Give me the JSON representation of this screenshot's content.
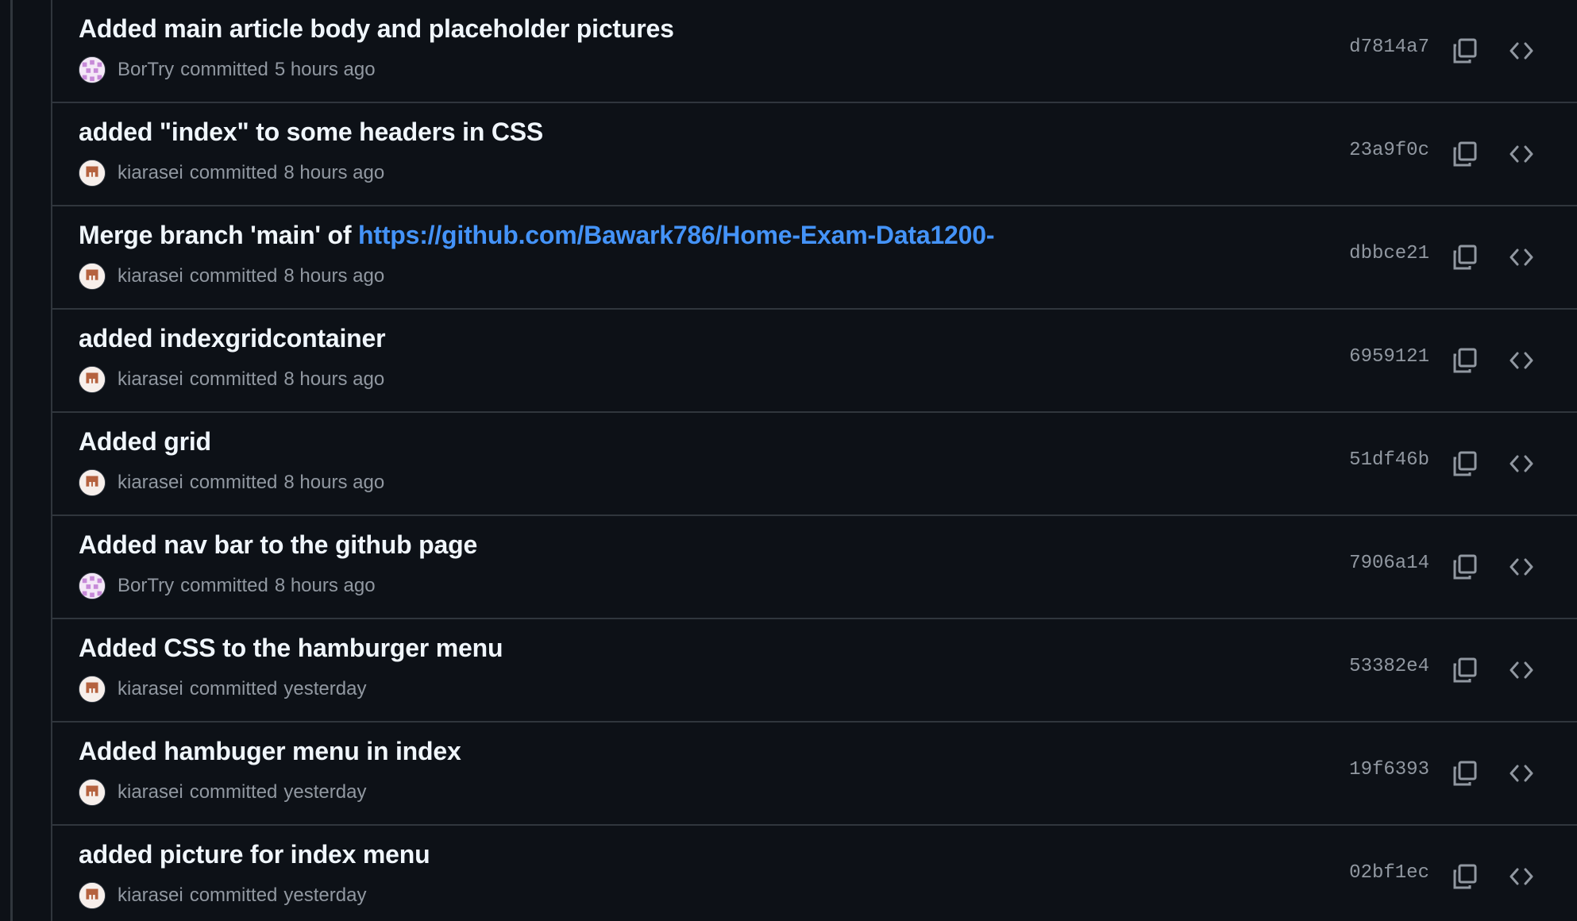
{
  "commits": [
    {
      "title": "Added main article body and placeholder pictures",
      "author": "BorTry",
      "avatar": "bortry-avatar",
      "verb": "committed",
      "time": "5 hours ago",
      "sha": "d7814a7"
    },
    {
      "title": "added \"index\" to some headers in CSS",
      "author": "kiarasei",
      "avatar": "kiarasei-avatar",
      "verb": "committed",
      "time": "8 hours ago",
      "sha": "23a9f0c"
    },
    {
      "title_prefix": "Merge branch 'main' of ",
      "title_link": "https://github.com/Bawark786/Home-Exam-Data1200-",
      "author": "kiarasei",
      "avatar": "kiarasei-avatar",
      "verb": "committed",
      "time": "8 hours ago",
      "sha": "dbbce21"
    },
    {
      "title": "added indexgridcontainer",
      "author": "kiarasei",
      "avatar": "kiarasei-avatar",
      "verb": "committed",
      "time": "8 hours ago",
      "sha": "6959121"
    },
    {
      "title": "Added grid",
      "author": "kiarasei",
      "avatar": "kiarasei-avatar",
      "verb": "committed",
      "time": "8 hours ago",
      "sha": "51df46b"
    },
    {
      "title": "Added nav bar to the github page",
      "author": "BorTry",
      "avatar": "bortry-avatar",
      "verb": "committed",
      "time": "8 hours ago",
      "sha": "7906a14"
    },
    {
      "title": "Added CSS to the hamburger menu",
      "author": "kiarasei",
      "avatar": "kiarasei-avatar",
      "verb": "committed",
      "time": "yesterday",
      "sha": "53382e4"
    },
    {
      "title": "Added hambuger menu in index",
      "author": "kiarasei",
      "avatar": "kiarasei-avatar",
      "verb": "committed",
      "time": "yesterday",
      "sha": "19f6393"
    },
    {
      "title": "added picture for index menu",
      "author": "kiarasei",
      "avatar": "kiarasei-avatar",
      "verb": "committed",
      "time": "yesterday",
      "sha": "02bf1ec"
    }
  ],
  "icons": {
    "copy": "copy-icon",
    "browse": "code-icon"
  },
  "colors": {
    "background": "#0d1117",
    "border": "#30363d",
    "title": "#f0f6fc",
    "muted": "#9198a1",
    "link": "#4493f8",
    "bortry_avatar": "#c78ad8",
    "kiarasei_avatar": "#b5623f"
  }
}
